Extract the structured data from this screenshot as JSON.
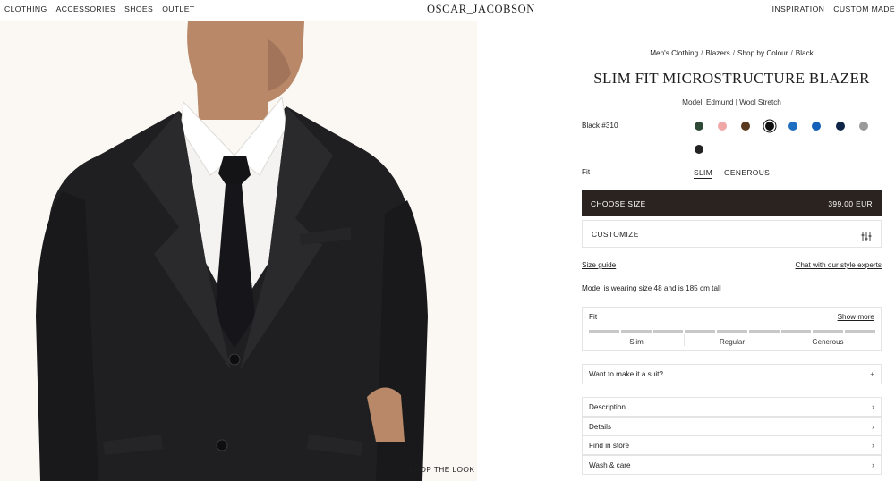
{
  "nav": {
    "left": [
      "CLOTHING",
      "ACCESSORIES",
      "SHOES",
      "OUTLET"
    ],
    "right": [
      "INSPIRATION",
      "CUSTOM MADE"
    ],
    "logo": "OSCAR_JACOBSON"
  },
  "hero": {
    "shop_the_look": "SHOP THE LOOK"
  },
  "breadcrumb": [
    "Men's Clothing",
    "Blazers",
    "Shop by Colour",
    "Black"
  ],
  "product": {
    "title": "SLIM FIT MICROSTRUCTURE BLAZER",
    "model": "Model: Edmund | Wool Stretch",
    "color_label": "Black #310",
    "swatches": [
      "#2e4a36",
      "#f0a7a7",
      "#5a3a1e",
      "#111111",
      "#1f6fc1",
      "#1560b8",
      "#0f2547",
      "#9a9a9a",
      "#222222"
    ],
    "selected_swatch": 3,
    "fit_label": "Fit",
    "fit_options": [
      "SLIM",
      "GENEROUS"
    ],
    "choose_size": "CHOOSE SIZE",
    "price": "399.00 EUR",
    "customize": "CUSTOMIZE",
    "size_guide": "Size guide",
    "chat": "Chat with our style experts",
    "wearing": "Model is wearing size 48 and is 185 cm tall"
  },
  "fitbox": {
    "title": "Fit",
    "show_more": "Show more",
    "scale": [
      "Slim",
      "Regular",
      "Generous"
    ]
  },
  "suit": {
    "label": "Want to make it a suit?",
    "icon": "plus-icon"
  },
  "accordion": [
    "Description",
    "Details",
    "Find in store",
    "Wash & care"
  ]
}
